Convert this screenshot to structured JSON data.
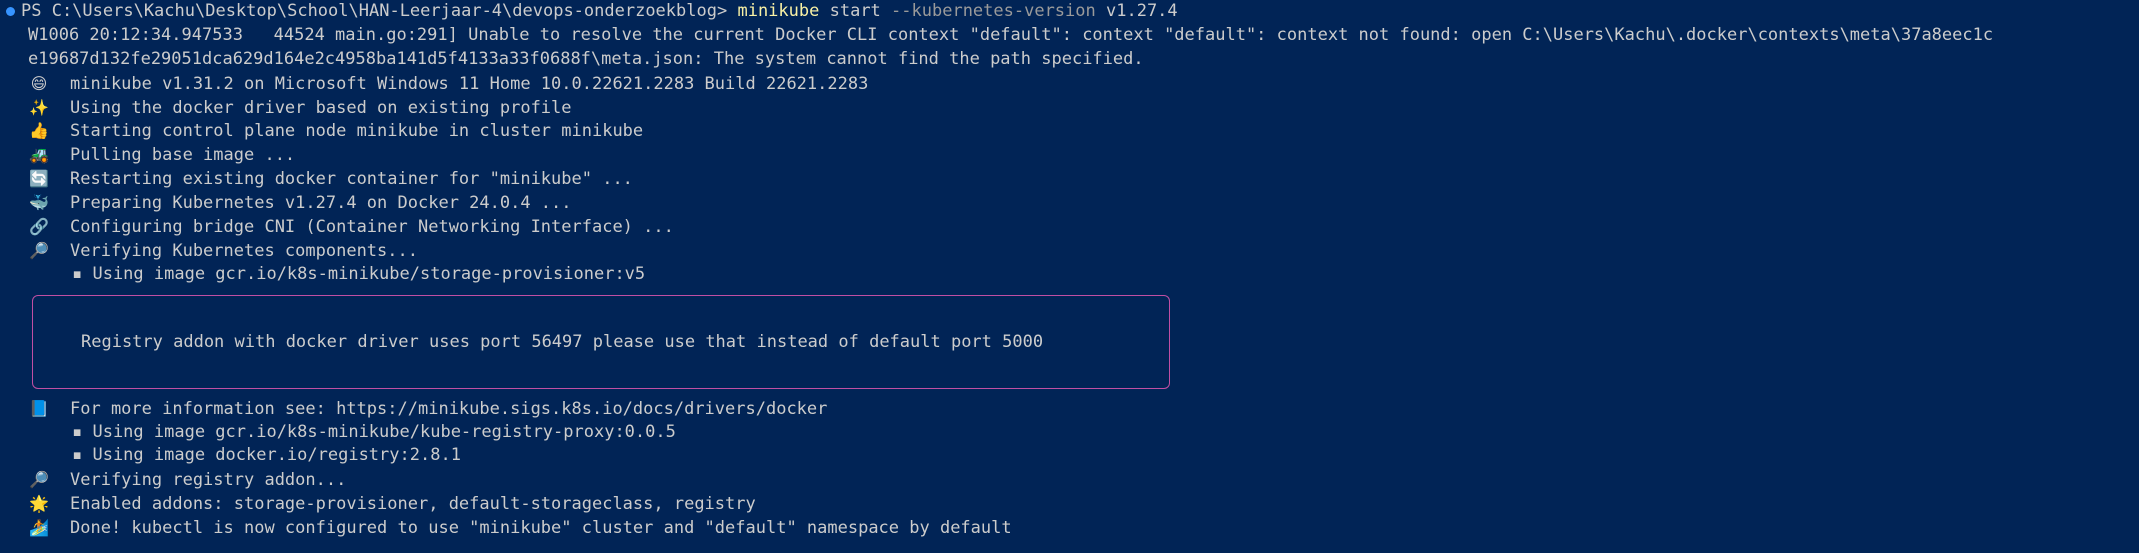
{
  "prompt": {
    "prefix": "PS C:\\Users\\Kachu\\Desktop\\School\\HAN-Leerjaar-4\\devops-onderzoekblog>",
    "command": "minikube",
    "arg": "start",
    "flag": "--kubernetes-version",
    "version": "v1.27.4"
  },
  "warning": {
    "line1": "W1006 20:12:34.947533   44524 main.go:291] Unable to resolve the current Docker CLI context \"default\": context \"default\": context not found: open C:\\Users\\Kachu\\.docker\\contexts\\meta\\37a8eec1c",
    "line2": "e19687d132fe29051dca629d164e2c4958ba141d5f4133a33f0688f\\meta.json: The system cannot find the path specified."
  },
  "lines": [
    {
      "icon": "😄",
      "icon_name": "smile-icon",
      "text": "minikube v1.31.2 on Microsoft Windows 11 Home 10.0.22621.2283 Build 22621.2283"
    },
    {
      "icon": "✨",
      "icon_name": "sparkles-icon",
      "text": "Using the docker driver based on existing profile"
    },
    {
      "icon": "👍",
      "icon_name": "thumbs-up-icon",
      "text": "Starting control plane node minikube in cluster minikube"
    },
    {
      "icon": "🚜",
      "icon_name": "tractor-icon",
      "text": "Pulling base image ..."
    },
    {
      "icon": "🔄",
      "icon_name": "restart-icon",
      "text": "Restarting existing docker container for \"minikube\" ..."
    },
    {
      "icon": "🐳",
      "icon_name": "whale-icon",
      "text": "Preparing Kubernetes v1.27.4 on Docker 24.0.4 ..."
    },
    {
      "icon": "🔗",
      "icon_name": "link-icon",
      "text": "Configuring bridge CNI (Container Networking Interface) ..."
    },
    {
      "icon": "🔎",
      "icon_name": "magnifier-icon",
      "text": "Verifying Kubernetes components..."
    }
  ],
  "sub1": "▪ Using image gcr.io/k8s-minikube/storage-provisioner:v5",
  "box_text": "Registry addon with docker driver uses port 56497 please use that instead of default port 5000",
  "after": [
    {
      "icon": "📘",
      "icon_name": "book-icon",
      "text": "For more information see: https://minikube.sigs.k8s.io/docs/drivers/docker"
    }
  ],
  "sub2": "▪ Using image gcr.io/k8s-minikube/kube-registry-proxy:0.0.5",
  "sub3": "▪ Using image docker.io/registry:2.8.1",
  "final": [
    {
      "icon": "🔎",
      "icon_name": "magnifier-icon",
      "text": "Verifying registry addon..."
    },
    {
      "icon": "🌟",
      "icon_name": "star-icon",
      "text": "Enabled addons: storage-provisioner, default-storageclass, registry"
    },
    {
      "icon": "🏄",
      "icon_name": "surfer-icon",
      "text": "Done! kubectl is now configured to use \"minikube\" cluster and \"default\" namespace by default"
    }
  ],
  "colors": {
    "background": "#012456",
    "text": "#cccccc",
    "command": "#f9f1a5",
    "flag": "#9a9a9a",
    "box_border": "#c04fa3",
    "prompt_dot": "#3794ff"
  }
}
